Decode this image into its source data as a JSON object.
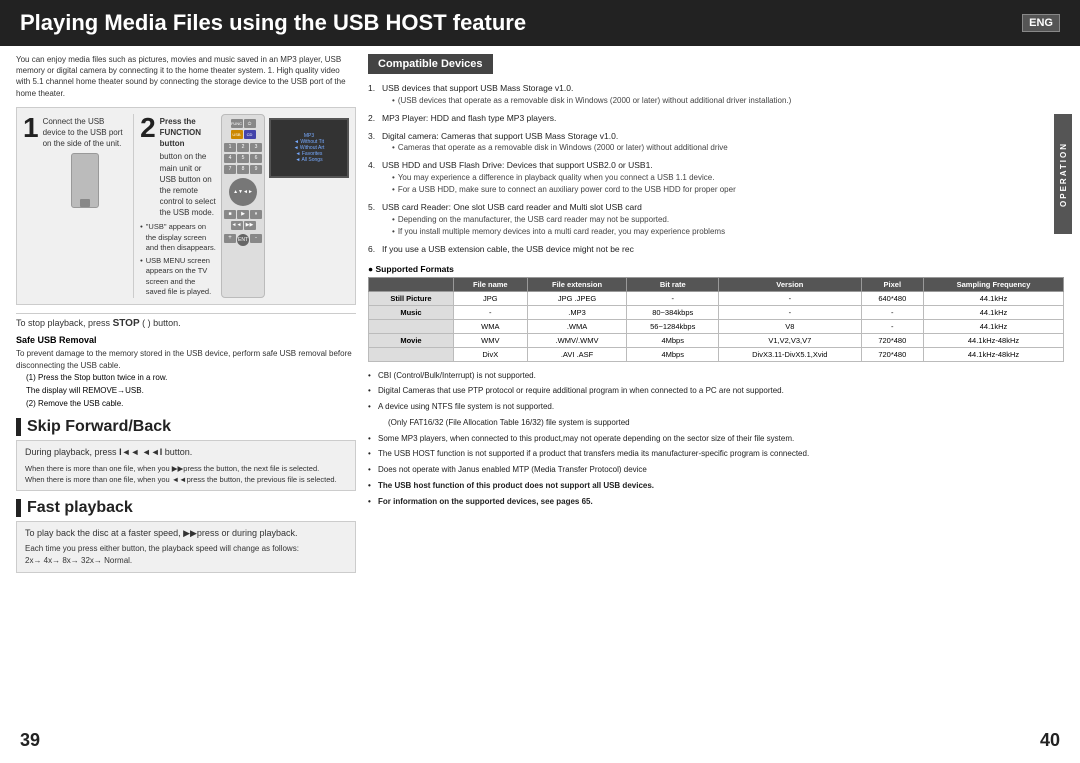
{
  "header": {
    "title": "Playing Media Files using the USB HOST feature",
    "badge": "ENG"
  },
  "intro": "You can enjoy media files such as pictures, movies and music saved in an MP3 player, USB memory or digital camera by connecting it to the home theater system. 1. High quality video with 5.1 channel home theater sound by connecting the storage device to the USB port of the home theater.",
  "compatible_devices": {
    "label": "Compatible Devices",
    "items": [
      {
        "num": "1",
        "text": "USB devices that support USB Mass Storage v1.0.",
        "sub": "(USB devices that operate as a removable disk in Windows (2000 or later) without additional driver installation.)"
      },
      {
        "num": "2",
        "text": "MP3 Player: HDD and flash type MP3 players."
      },
      {
        "num": "3",
        "text": "Digital camera: Cameras that support USB Mass Storage v1.0.",
        "sub": "Cameras that operate as a removable disk in Windows (2000 or later) without additional drive"
      },
      {
        "num": "4",
        "text": "USB HDD and USB Flash Drive: Devices that support USB2.0 or USB1.",
        "sub1": "You may experience a difference in playback quality when you connect a USB 1.1 device.",
        "sub2": "For a USB HDD, make sure to connect an auxiliary power cord to the USB HDD for proper oper"
      },
      {
        "num": "5",
        "text": "USB card Reader: One slot USB card reader and Multi slot USB card",
        "sub1": "Depending on the manufacturer, the USB card reader may not be supported.",
        "sub2": "If you install multiple memory devices into a multi card reader, you may experience problems"
      },
      {
        "num": "6",
        "text": "If you use a USB extension cable, the USB device might not be rec"
      }
    ]
  },
  "supported_formats": {
    "title": "Supported Formats",
    "columns": [
      "File name",
      "File extension",
      "Bit rate",
      "Version",
      "Pixel",
      "Sampling Frequency"
    ],
    "rows": [
      {
        "category": "Still Picture",
        "name": "JPG",
        "ext": "JPG  .JPEG",
        "bitrate": "-",
        "version": "-",
        "pixel": "640*480",
        "freq": "44.1kHz"
      },
      {
        "category": "Music",
        "name": "-",
        "ext": ".MP3",
        "bitrate": "80~384kbps",
        "version": "-",
        "pixel": "-",
        "freq": "44.1kHz"
      },
      {
        "category": "",
        "name": "WMA",
        "ext": ".WMA",
        "bitrate": "56~1284kbps",
        "version": "V8",
        "pixel": "-",
        "freq": "44.1kHz"
      },
      {
        "category": "Movie",
        "name": "WMV",
        "ext": ".WMV/.WMV",
        "bitrate": "4Mbps",
        "version": "V1,V2,V3,V7",
        "pixel": "720*480",
        "freq": "44.1kHz-48kHz"
      },
      {
        "category": "",
        "name": "DivX",
        "ext": ".AVI .ASF",
        "bitrate": "4Mbps",
        "version": "DivX3.11-DivX5.1,Xvid",
        "pixel": "720*480",
        "freq": "44.1kHz-48kHz"
      }
    ]
  },
  "bottom_notes": [
    "CBI (Control/Bulk/Interrupt) is not supported.",
    "Digital Cameras that use PTP protocol or require additional program in when connected to a PC are not supported.",
    "A device using NTFS file system is not supported.",
    "(Only FAT16/32 (File Allocation Table 16/32) file system is supported",
    "Some MP3 players, when connected to this product,may not operate depending on the sector size of their file system.",
    "The USB HOST function is not supported if a product that transfers media its manufacturer-specific program is connected.",
    "Does not operate with Janus enabled MTP (Media Transfer Protocol) device"
  ],
  "bold_notes": [
    "The USB host function of this product does not support all USB devices.",
    "For information on the supported devices, see pages 65."
  ],
  "operation_label": "OPERATION",
  "step1": {
    "number": "1",
    "text": "Connect the USB device to the USB port on the side of the unit."
  },
  "step2": {
    "number": "2",
    "title": "Press the FUNCTION button",
    "text": "button on the main unit or USB button on the remote control to select the USB mode."
  },
  "step_notes": [
    "\"USB\" appears on the display screen and then disappears.",
    "USB MENU screen appears on the TV screen and the saved file is played."
  ],
  "stop_section": {
    "text": "To stop playback, press",
    "bold": "STOP",
    "text2": "( ) button."
  },
  "safe_usb": {
    "title": "Safe USB Removal",
    "intro": "To prevent damage to the memory stored in the USB device, perform safe USB removal before disconnecting the USB cable.",
    "steps": [
      "(1)  Press the Stop button twice in a row.\n      The display will REMOVE→USB.",
      "(2)  Remove the USB cable."
    ]
  },
  "skip_section": {
    "title": "Skip Forward/Back",
    "main_text": "During playback, press",
    "bold_text": "I◄◄ ◄◄I",
    "end_text": "button.",
    "notes": [
      "When there is more than one file, when you ▶▶press the button, the next file is selected.",
      "When there is more than one file, when you ◄◄press the button, the previous file is selected."
    ]
  },
  "fast_section": {
    "title": "Fast playback",
    "main_text": "To play back the disc at a faster speed, ▶▶press",
    "end_text": "or",
    "during_text": "during playback.",
    "notes": [
      "Each time you press either button, the playback speed will change as follows:",
      "2x→ 4x→ 8x→ 32x→ Normal."
    ]
  },
  "page_numbers": {
    "left": "39",
    "right": "40"
  }
}
